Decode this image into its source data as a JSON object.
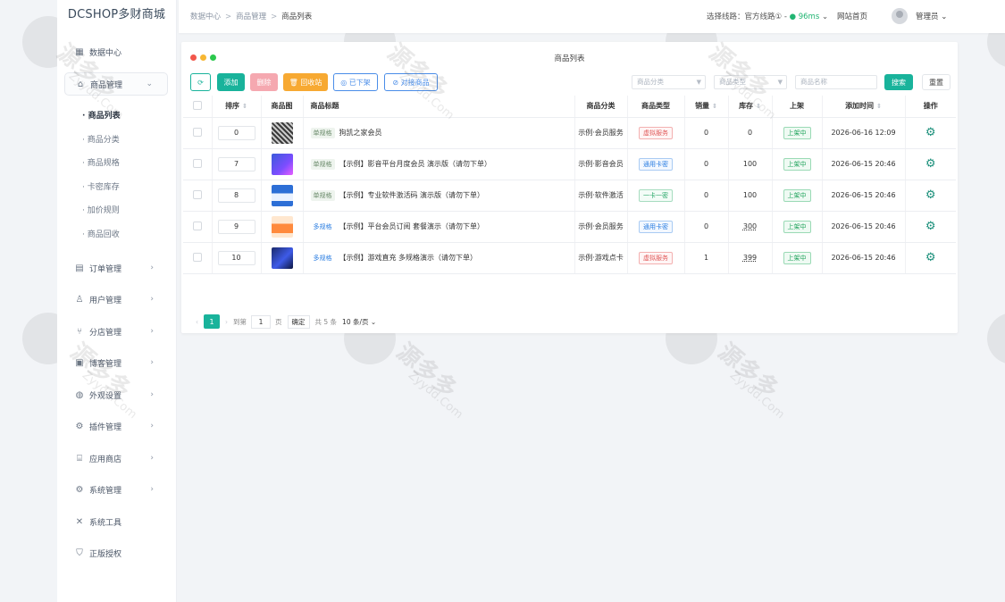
{
  "brand": "DCSHOP多财商城",
  "sidebar": {
    "items": [
      {
        "label": "数据中心",
        "icon": "dashboard-icon"
      },
      {
        "label": "商品管理",
        "icon": "bag-icon"
      },
      {
        "label": "订单管理",
        "icon": "order-icon"
      },
      {
        "label": "用户管理",
        "icon": "user-icon"
      },
      {
        "label": "分店管理",
        "icon": "branch-icon"
      },
      {
        "label": "博客管理",
        "icon": "blog-icon"
      },
      {
        "label": "外观设置",
        "icon": "palette-icon"
      },
      {
        "label": "插件管理",
        "icon": "plugin-icon"
      },
      {
        "label": "应用商店",
        "icon": "store-icon"
      },
      {
        "label": "系统管理",
        "icon": "settings-icon"
      },
      {
        "label": "系统工具",
        "icon": "tools-icon"
      },
      {
        "label": "正版授权",
        "icon": "shield-icon"
      }
    ],
    "sub_items": [
      {
        "label": "商品列表"
      },
      {
        "label": "商品分类"
      },
      {
        "label": "商品规格"
      },
      {
        "label": "卡密库存"
      },
      {
        "label": "加价规则"
      },
      {
        "label": "商品回收"
      }
    ]
  },
  "topbar": {
    "breadcrumb": [
      "数据中心",
      "商品管理",
      "商品列表"
    ],
    "line_label": "选择线路：官方线路①",
    "line_ms": "96ms",
    "home": "网站首页",
    "admin": "管理员"
  },
  "panel": {
    "title": "商品列表",
    "toolbar": {
      "add": "添加",
      "delete": "删除",
      "recycle": "回收站",
      "off_shelf": "已下架",
      "dock": "对接商品"
    },
    "filters": {
      "category_placeholder": "商品分类",
      "type_placeholder": "商品类型",
      "name_placeholder": "商品名称",
      "search": "搜索",
      "reset": "重置"
    },
    "columns": [
      "排序",
      "商品图",
      "商品标题",
      "商品分类",
      "商品类型",
      "销量",
      "库存",
      "上架",
      "添加时间",
      "操作"
    ],
    "rows": [
      {
        "sort": "0",
        "spec": "单规格",
        "title": "狗凯之家会员",
        "category": "示例·会员服务",
        "type": "虚拟服务",
        "sales": "0",
        "stock": "0",
        "status": "上架中",
        "time": "2026-06-16 12:09"
      },
      {
        "sort": "7",
        "spec": "单规格",
        "title": "【示例】影音平台月度会员 演示版（请勿下单）",
        "category": "示例·影音会员",
        "type": "通用卡密",
        "sales": "0",
        "stock": "100",
        "status": "上架中",
        "time": "2026-06-15 20:46"
      },
      {
        "sort": "8",
        "spec": "单规格",
        "title": "【示例】专业软件激活码 演示版（请勿下单）",
        "category": "示例·软件激活",
        "type": "一卡一密",
        "sales": "0",
        "stock": "100",
        "status": "上架中",
        "time": "2026-06-15 20:46"
      },
      {
        "sort": "9",
        "spec": "多规格",
        "title": "【示例】平台会员订阅 套餐演示（请勿下单）",
        "category": "示例·会员服务",
        "type": "通用卡密",
        "sales": "0",
        "stock": "300",
        "status": "上架中",
        "time": "2026-06-15 20:46"
      },
      {
        "sort": "10",
        "spec": "多规格",
        "title": "【示例】游戏直充 多规格演示（请勿下单）",
        "category": "示例·游戏点卡",
        "type": "虚拟服务",
        "sales": "1",
        "stock": "399",
        "status": "上架中",
        "time": "2026-06-15 20:46"
      }
    ],
    "pager": {
      "current": "1",
      "goto": "到第",
      "page_input": "1",
      "page_unit": "页",
      "confirm": "确定",
      "total": "共 5 条",
      "page_size": "10 条/页"
    }
  },
  "watermark": {
    "text": "源多多",
    "sub": "Zyydd.Com"
  },
  "colors": {
    "primary": "#19b39b",
    "danger": "#f5a8b0",
    "warning": "#f7a932",
    "info": "#4a8de8"
  }
}
